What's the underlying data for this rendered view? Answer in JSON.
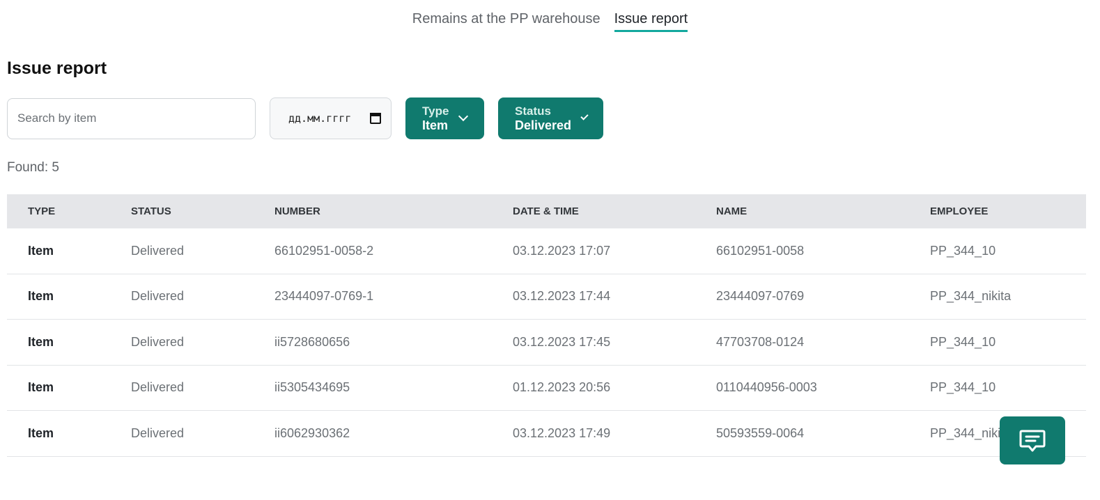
{
  "tabs": [
    {
      "label": "Remains at the PP warehouse",
      "active": false
    },
    {
      "label": "Issue report",
      "active": true
    }
  ],
  "page_title": "Issue report",
  "filters": {
    "search_placeholder": "Search by item",
    "date_placeholder": "дд.мм.гггг",
    "type": {
      "caption": "Type",
      "value": "Item"
    },
    "status": {
      "caption": "Status",
      "value": "Delivered"
    }
  },
  "found_text": "Found: 5",
  "table": {
    "headers": [
      "TYPE",
      "STATUS",
      "NUMBER",
      "DATE & TIME",
      "NAME",
      "EMPLOYEE"
    ],
    "rows": [
      {
        "type": "Item",
        "status": "Delivered",
        "number": "66102951-0058-2",
        "datetime": "03.12.2023 17:07",
        "name": "66102951-0058",
        "employee": "PP_344_10"
      },
      {
        "type": "Item",
        "status": "Delivered",
        "number": "23444097-0769-1",
        "datetime": "03.12.2023 17:44",
        "name": "23444097-0769",
        "employee": "PP_344_nikita"
      },
      {
        "type": "Item",
        "status": "Delivered",
        "number": "ii5728680656",
        "datetime": "03.12.2023 17:45",
        "name": "47703708-0124",
        "employee": "PP_344_10"
      },
      {
        "type": "Item",
        "status": "Delivered",
        "number": "ii5305434695",
        "datetime": "01.12.2023 20:56",
        "name": "0110440956-0003",
        "employee": "PP_344_10"
      },
      {
        "type": "Item",
        "status": "Delivered",
        "number": "ii6062930362",
        "datetime": "03.12.2023 17:49",
        "name": "50593559-0064",
        "employee": "PP_344_nikita"
      }
    ]
  },
  "chat_button": {
    "icon": "chat-icon"
  },
  "colors": {
    "accent": "#107a6e",
    "tab_underline": "#13a89e",
    "header_bg": "#e5e6e9"
  }
}
